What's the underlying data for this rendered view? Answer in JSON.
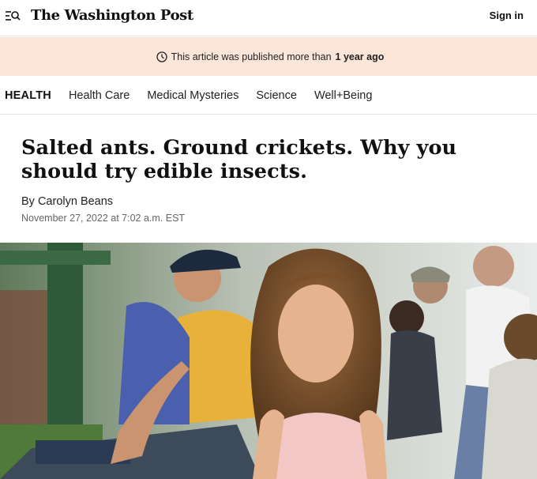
{
  "header": {
    "logo_text": "The Washington Post",
    "signin_label": "Sign in",
    "menu_icon": "menu-search-icon"
  },
  "banner": {
    "prefix": "This article was published more than",
    "emphasis": "1 year ago",
    "icon": "clock-icon",
    "background": "#fbe6d8"
  },
  "section_nav": {
    "section": "HEALTH",
    "items": [
      {
        "label": "Health Care"
      },
      {
        "label": "Medical Mysteries"
      },
      {
        "label": "Science"
      },
      {
        "label": "Well+Being"
      }
    ]
  },
  "article": {
    "headline": "Salted ants. Ground crickets. Why you should try edible insects.",
    "byline_prefix": "By",
    "author": "Carolyn Beans",
    "date": "November 27, 2022 at 7:02 a.m. EST"
  }
}
